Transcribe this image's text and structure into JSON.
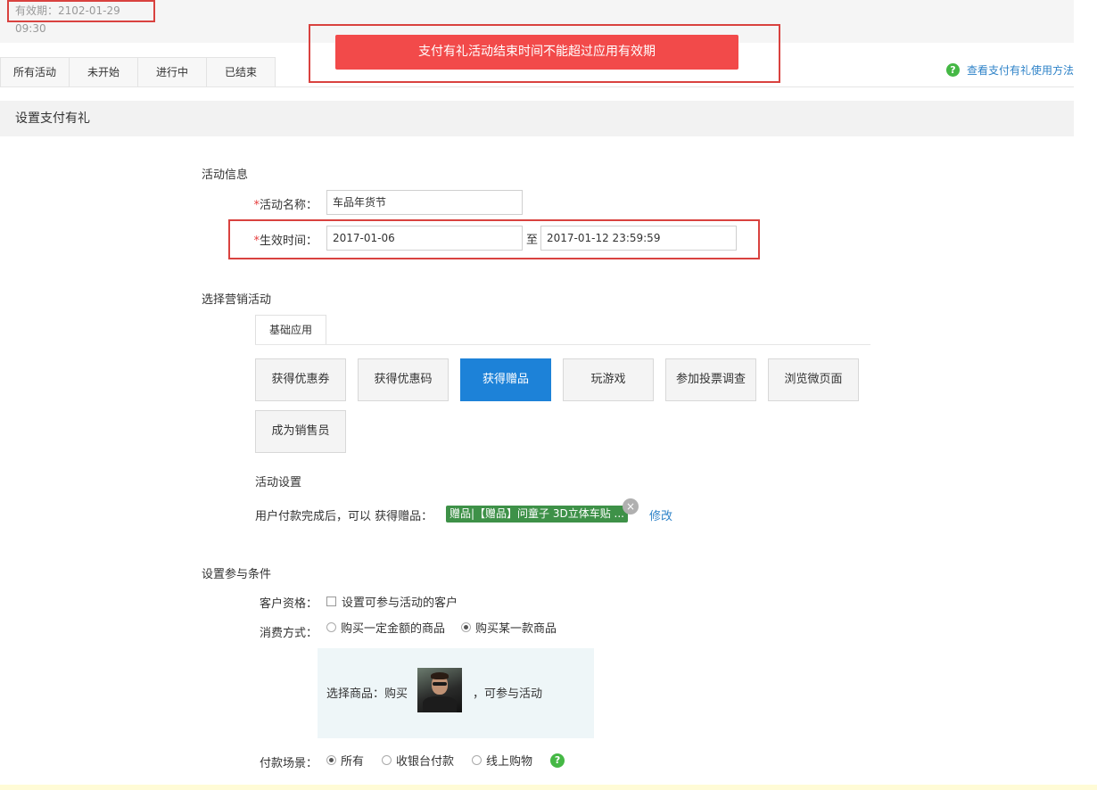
{
  "header": {
    "validity": "有效期：2102-01-29 09:30",
    "alert": "支付有礼活动结束时间不能超过应用有效期"
  },
  "tabs": [
    "所有活动",
    "未开始",
    "进行中",
    "已结束"
  ],
  "help": {
    "icon": "?",
    "label": "查看支付有礼使用方法"
  },
  "section_title": "设置支付有礼",
  "activity_info": {
    "heading": "活动信息",
    "name_label": "活动名称：",
    "name_value": "车品年货节",
    "time_label": "生效时间：",
    "required_mark": "*",
    "start_date": "2017-01-06",
    "to": "至",
    "end_date": "2017-01-12 23:59:59"
  },
  "marketing": {
    "heading": "选择营销活动",
    "tab": "基础应用",
    "buttons": [
      "获得优惠券",
      "获得优惠码",
      "获得赠品",
      "玩游戏",
      "参加投票调查",
      "浏览微页面",
      "成为销售员"
    ],
    "active_button": "获得赠品"
  },
  "activity_settings": {
    "heading": "活动设置",
    "text": "用户付款完成后，可以 获得赠品：",
    "gift_tag": "赠品|【赠品】问童子 3D立体车贴 ...",
    "close": "×",
    "modify": "修改"
  },
  "conditions": {
    "heading": "设置参与条件",
    "customer_label": "客户资格：",
    "customer_checkbox": "设置可参与活动的客户",
    "consume_label": "消费方式：",
    "consume_options": [
      "购买一定金额的商品",
      "购买某一款商品"
    ],
    "consume_selected": "购买某一款商品",
    "product_prefix": "选择商品：购买",
    "product_suffix": "，可参与活动",
    "payment_label": "付款场景：",
    "payment_options": [
      "所有",
      "收银台付款",
      "线上购物"
    ],
    "payment_selected": "所有",
    "payment_help": "?"
  },
  "colors": {
    "alert_bg": "#f24a4a",
    "highlight_border": "#d9423f",
    "active_button": "#1d82d8",
    "gift_tag": "#3e9148",
    "link": "#2f83c8",
    "help_icon": "#45b845"
  }
}
